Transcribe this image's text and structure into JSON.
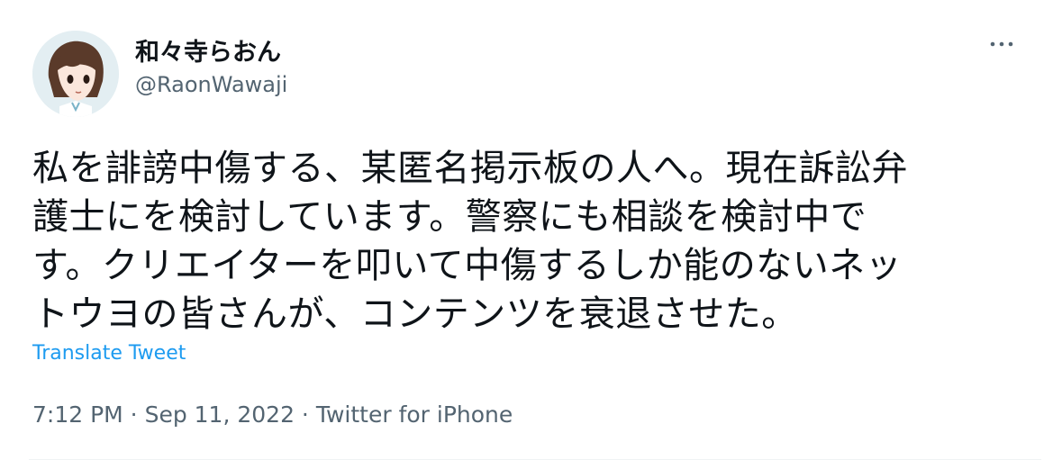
{
  "author": {
    "display_name": "和々寺らおん",
    "handle": "@RaonWawaji",
    "avatar_icon": "anime-girl-avatar-icon"
  },
  "menu": {
    "more_icon": "more-dots-icon"
  },
  "tweet": {
    "text_lines": [
      "私を誹謗中傷する、某匿名掲示板の人へ。現在訴訟弁",
      "護士にを検討しています。警察にも相談を検討中で",
      "す。クリエイターを叩いて中傷するしか能のないネッ",
      "トウヨの皆さんが、コンテンツを衰退させた。"
    ],
    "translate_label": "Translate Tweet"
  },
  "meta": {
    "time": "7:12 PM",
    "separator": " · ",
    "date": "Sep 11, 2022",
    "source": "Twitter for iPhone"
  },
  "colors": {
    "text": "#0f1419",
    "secondary": "#536471",
    "link": "#1d9bf0"
  }
}
